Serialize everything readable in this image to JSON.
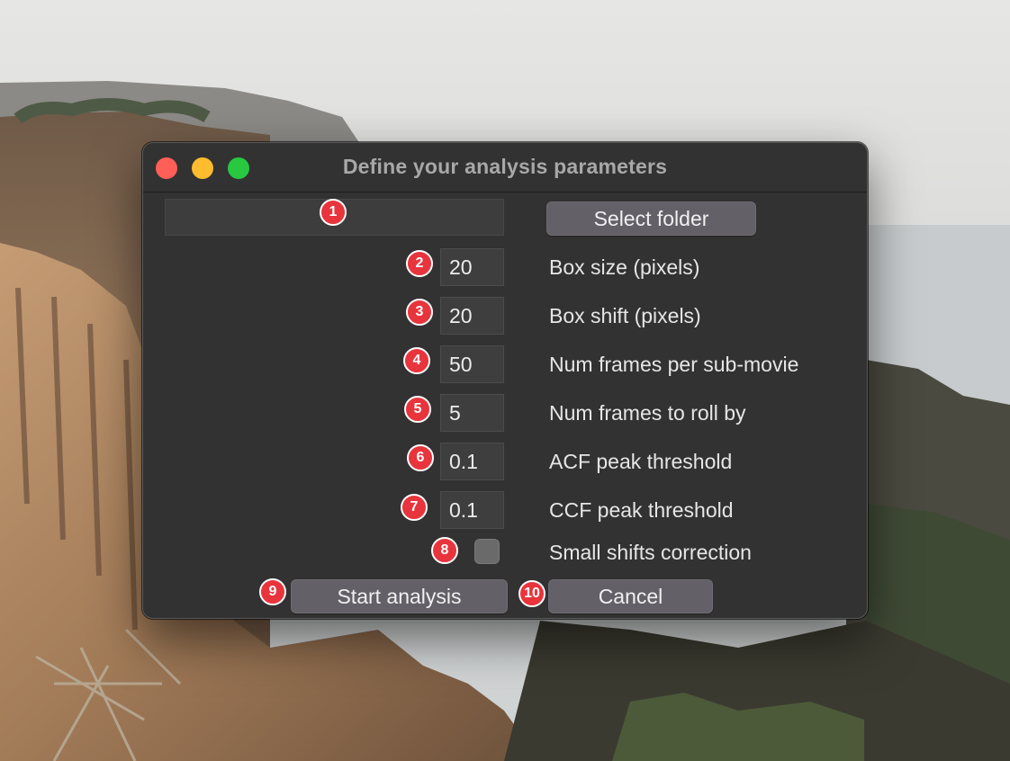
{
  "window": {
    "title": "Define your analysis parameters"
  },
  "folder": {
    "path_value": "",
    "select_button_label": "Select folder"
  },
  "params": [
    {
      "value": "20",
      "label": "Box size (pixels)"
    },
    {
      "value": "20",
      "label": "Box shift (pixels)"
    },
    {
      "value": "50",
      "label": "Num frames per sub-movie"
    },
    {
      "value": "5",
      "label": "Num frames to roll by"
    },
    {
      "value": "0.1",
      "label": "ACF peak threshold"
    },
    {
      "value": "0.1",
      "label": "CCF peak threshold"
    }
  ],
  "small_shifts": {
    "label": "Small shifts correction",
    "checked": false
  },
  "actions": {
    "start_label": "Start analysis",
    "cancel_label": "Cancel"
  },
  "markers": [
    "1",
    "2",
    "3",
    "4",
    "5",
    "6",
    "7",
    "8",
    "9",
    "10"
  ],
  "colors": {
    "window_bg": "#323232",
    "button_bg": "#636068",
    "marker_red": "#e8343c",
    "close_red": "#ff5f57",
    "minimize_yellow": "#febc2e",
    "zoom_green": "#28c840"
  }
}
